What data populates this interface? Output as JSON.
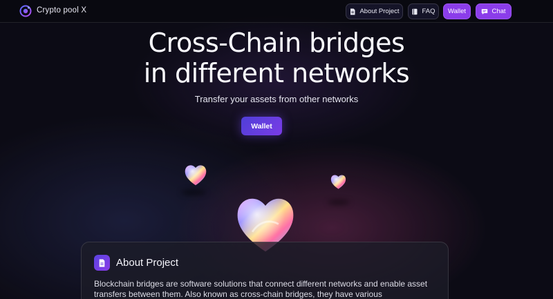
{
  "header": {
    "brand": "Crypto pool X",
    "logo_icon": "crypto-pool-logo-icon",
    "nav": [
      {
        "label": "About Project",
        "icon": "document-icon",
        "style": "secondary"
      },
      {
        "label": "FAQ",
        "icon": "book-icon",
        "style": "secondary"
      },
      {
        "label": "Wallet",
        "icon": "",
        "style": "primary"
      },
      {
        "label": "Chat",
        "icon": "chat-icon",
        "style": "primary"
      }
    ]
  },
  "hero": {
    "title_line1": "Cross-Chain bridges",
    "title_line2": "in different networks",
    "subtitle": "Transfer your assets from other networks",
    "cta_label": "Wallet"
  },
  "about": {
    "icon": "document-icon",
    "title": "About Project",
    "text": "Blockchain bridges are software solutions that connect different networks and enable asset transfers between them. Also known as cross-chain bridges, they have various"
  },
  "colors": {
    "accent": "#8b3dea",
    "background": "#0c0b15",
    "card": "#1c1c28"
  }
}
